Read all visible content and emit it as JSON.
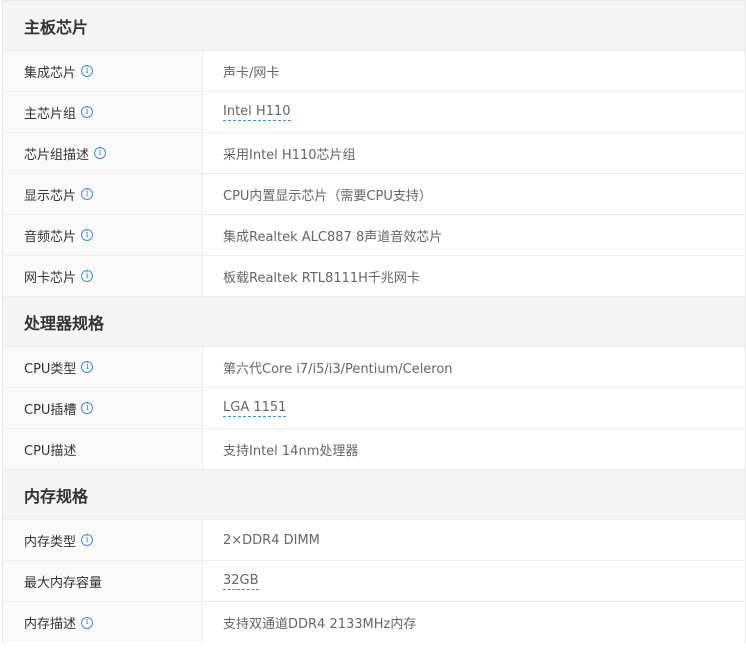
{
  "sections": [
    {
      "title": "主板芯片",
      "rows": [
        {
          "label": "集成芯片",
          "value": "声卡/网卡",
          "info": true,
          "link": false
        },
        {
          "label": "主芯片组",
          "value": "Intel H110",
          "info": true,
          "link": true
        },
        {
          "label": "芯片组描述",
          "value": "采用Intel H110芯片组",
          "info": true,
          "link": false
        },
        {
          "label": "显示芯片",
          "value": "CPU内置显示芯片（需要CPU支持）",
          "info": true,
          "link": false
        },
        {
          "label": "音频芯片",
          "value": "集成Realtek ALC887 8声道音效芯片",
          "info": true,
          "link": false
        },
        {
          "label": "网卡芯片",
          "value": "板载Realtek RTL8111H千兆网卡",
          "info": true,
          "link": false
        }
      ]
    },
    {
      "title": "处理器规格",
      "rows": [
        {
          "label": "CPU类型",
          "value": "第六代Core i7/i5/i3/Pentium/Celeron",
          "info": true,
          "link": false
        },
        {
          "label": "CPU插槽",
          "value": "LGA 1151",
          "info": true,
          "link": true
        },
        {
          "label": "CPU描述",
          "value": "支持Intel 14nm处理器",
          "info": false,
          "link": false
        }
      ]
    },
    {
      "title": "内存规格",
      "rows": [
        {
          "label": "内存类型",
          "value": "2×DDR4 DIMM",
          "info": true,
          "link": false
        },
        {
          "label": "最大内存容量",
          "value": "32GB",
          "info": false,
          "link": true
        },
        {
          "label": "内存描述",
          "value": "支持双通道DDR4 2133MHz内存",
          "info": true,
          "link": false
        }
      ]
    }
  ],
  "info_icon_glyph": "i",
  "colors": {
    "accent": "#3b8fd9",
    "header_bg": "#f5f5f5",
    "label_bg": "#fafafa",
    "value_text": "#666666",
    "label_text": "#333333"
  }
}
